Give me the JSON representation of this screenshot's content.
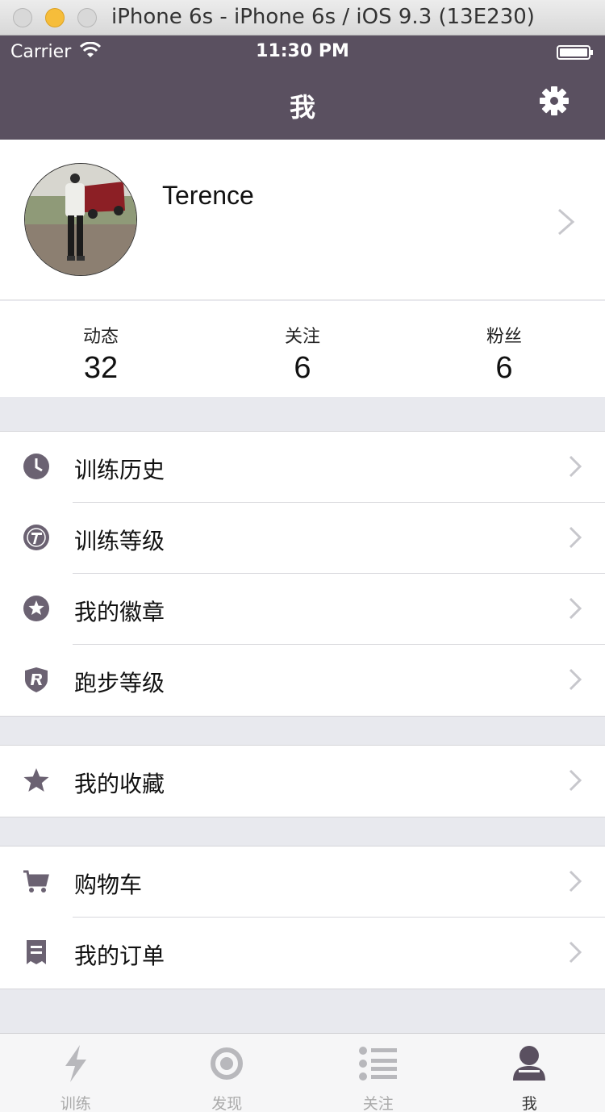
{
  "window": {
    "title": "iPhone 6s - iPhone 6s / iOS 9.3 (13E230)"
  },
  "status_bar": {
    "carrier": "Carrier",
    "time": "11:30 PM"
  },
  "nav": {
    "title": "我",
    "settings_icon": "gear-icon"
  },
  "profile": {
    "name": "Terence"
  },
  "stats": [
    {
      "label": "动态",
      "value": "32"
    },
    {
      "label": "关注",
      "value": "6"
    },
    {
      "label": "粉丝",
      "value": "6"
    }
  ],
  "menu_groups": [
    {
      "items": [
        {
          "label": "训练历史",
          "icon": "clock-icon"
        },
        {
          "label": "训练等级",
          "icon": "t-badge-icon"
        },
        {
          "label": "我的徽章",
          "icon": "star-badge-icon"
        },
        {
          "label": "跑步等级",
          "icon": "r-shield-icon"
        }
      ]
    },
    {
      "items": [
        {
          "label": "我的收藏",
          "icon": "star-icon"
        }
      ]
    },
    {
      "items": [
        {
          "label": "购物车",
          "icon": "cart-icon"
        },
        {
          "label": "我的订单",
          "icon": "receipt-icon"
        }
      ]
    }
  ],
  "tabbar": [
    {
      "label": "训练",
      "icon": "lightning-icon",
      "active": false
    },
    {
      "label": "发现",
      "icon": "target-icon",
      "active": false
    },
    {
      "label": "关注",
      "icon": "list-icon",
      "active": false
    },
    {
      "label": "我",
      "icon": "person-icon",
      "active": true
    }
  ],
  "colors": {
    "nav_bg": "#5a5060",
    "icon": "#6b6272",
    "separator": "#e8e9ee"
  }
}
